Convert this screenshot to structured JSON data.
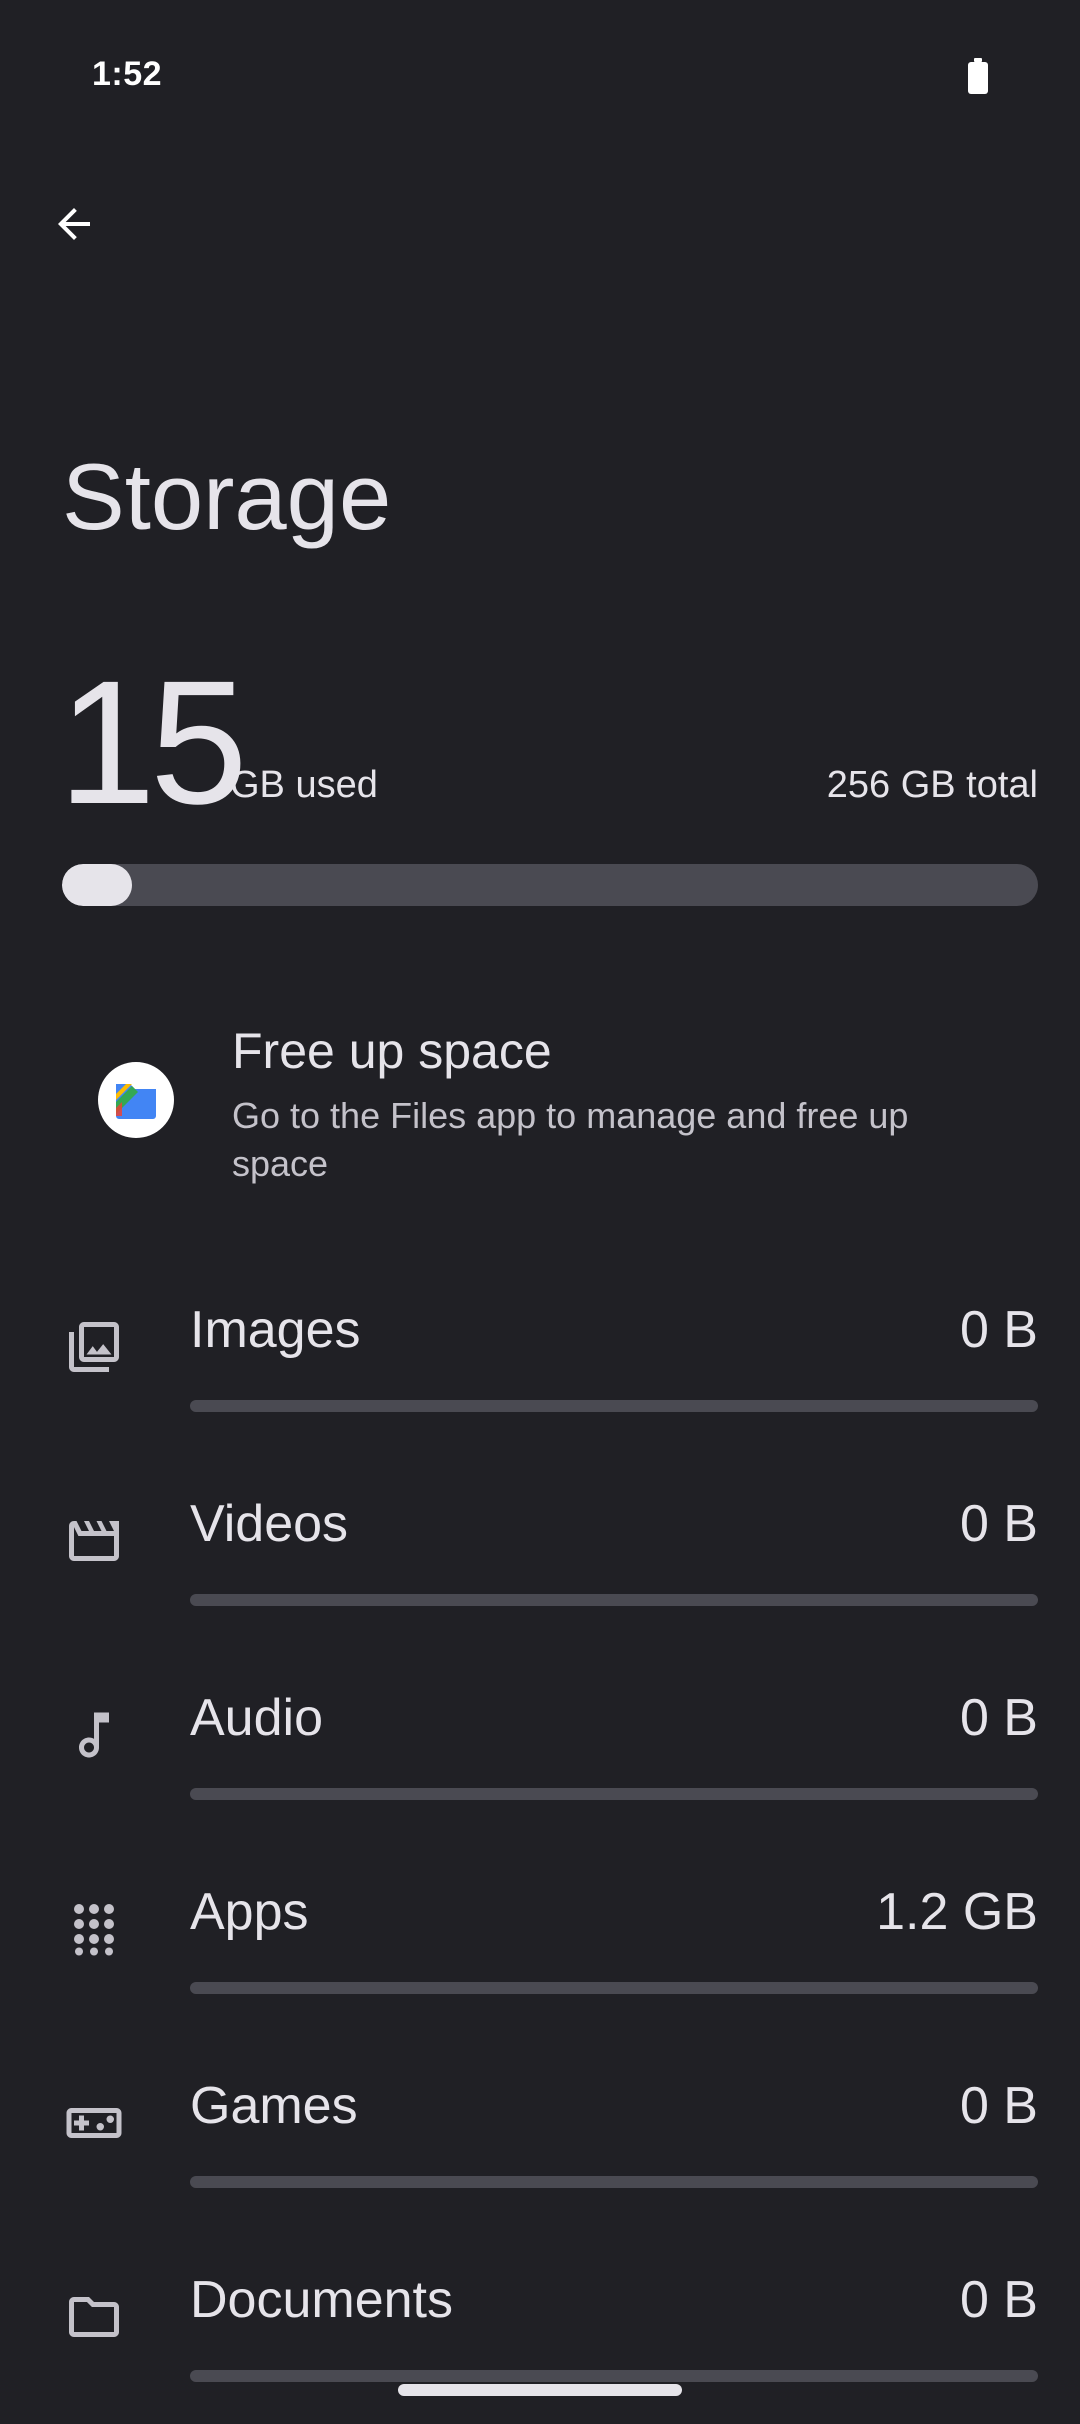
{
  "status_bar": {
    "time": "1:52",
    "battery_icon": "battery-full-icon"
  },
  "toolbar": {
    "back_icon": "arrow-back-icon"
  },
  "page": {
    "title": "Storage"
  },
  "summary": {
    "used_value": "15",
    "used_unit": "GB used",
    "total": "256 GB total",
    "used_fraction": 0.0586
  },
  "free_up": {
    "icon": "files-app-icon",
    "title": "Free up space",
    "subtitle": "Go to the Files app to manage and free up space"
  },
  "categories": [
    {
      "label": "Images",
      "size": "0 B",
      "icon": "image-icon",
      "fraction": 0
    },
    {
      "label": "Videos",
      "size": "0 B",
      "icon": "movie-clapper-icon",
      "fraction": 0
    },
    {
      "label": "Audio",
      "size": "0 B",
      "icon": "music-note-icon",
      "fraction": 0
    },
    {
      "label": "Apps",
      "size": "1.2 GB",
      "icon": "apps-grid-icon",
      "fraction": 0
    },
    {
      "label": "Games",
      "size": "0 B",
      "icon": "gamepad-icon",
      "fraction": 0
    },
    {
      "label": "Documents",
      "size": "0 B",
      "icon": "folder-icon",
      "fraction": 0
    }
  ],
  "colors": {
    "background": "#202025",
    "text": "#e6e4ea",
    "track": "#4a4a52"
  }
}
